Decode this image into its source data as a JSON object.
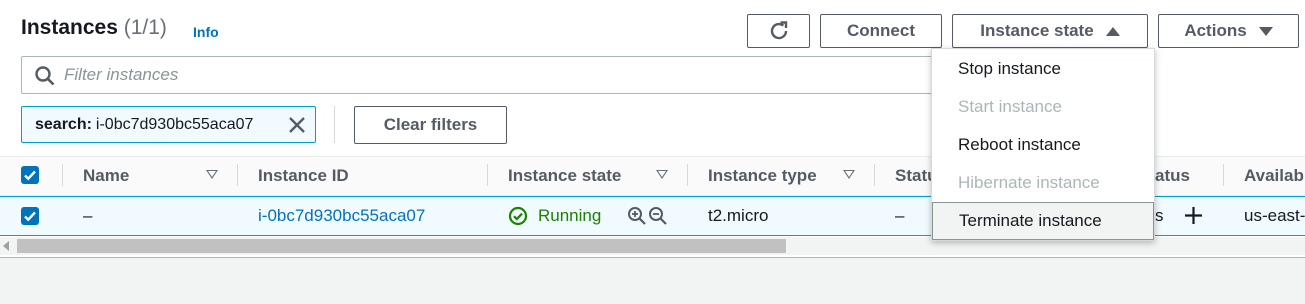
{
  "header": {
    "title": "Instances",
    "count": "(1/1)",
    "info": "Info"
  },
  "toolbar": {
    "connect": "Connect",
    "instance_state": "Instance state",
    "actions": "Actions"
  },
  "search": {
    "placeholder": "Filter instances",
    "value": ""
  },
  "filter_token": {
    "key": "search:",
    "value": "i-0bc7d930bc55aca07"
  },
  "clear_filters": "Clear filters",
  "table": {
    "columns": [
      "Name",
      "Instance ID",
      "Instance state",
      "Instance type",
      "Statu",
      "atus",
      "Availab"
    ],
    "row": {
      "name": "–",
      "instance_id": "i-0bc7d930bc55aca07",
      "instance_state": "Running",
      "instance_type": "t2.micro",
      "status_check": "–",
      "alarm_status_fragment": "s",
      "availability_zone": "us-east-"
    }
  },
  "instance_state_menu": {
    "items": [
      {
        "label": "Stop instance",
        "enabled": true
      },
      {
        "label": "Start instance",
        "enabled": false
      },
      {
        "label": "Reboot instance",
        "enabled": true
      },
      {
        "label": "Hibernate instance",
        "enabled": false
      },
      {
        "label": "Terminate instance",
        "enabled": true,
        "hovered": true
      }
    ]
  },
  "colors": {
    "link": "#0073bb",
    "running": "#1d8102",
    "disabled": "#aab7b8",
    "selection": "#00a1c9"
  }
}
